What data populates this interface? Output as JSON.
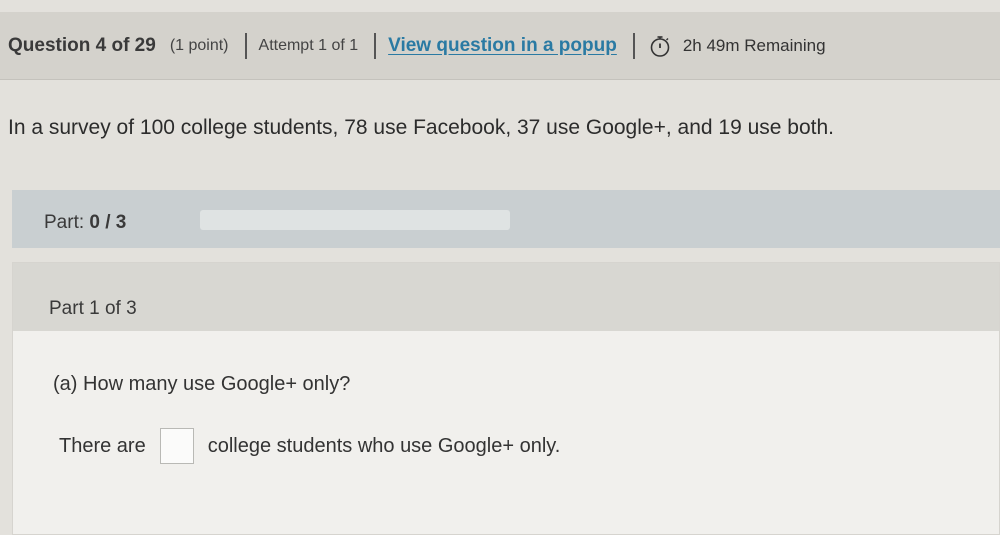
{
  "header": {
    "question_label": "Question 4 of 29",
    "points": "(1 point)",
    "attempt": "Attempt 1 of 1",
    "popup_link": "View question in a popup",
    "time_remaining": "2h 49m Remaining"
  },
  "question": {
    "text": "In a survey of 100 college students, 78 use Facebook, 37 use Google+, and 19 use both."
  },
  "progress": {
    "label": "Part:",
    "completed": "0",
    "total": "3",
    "value": "0 / 3",
    "fraction": 0
  },
  "part1": {
    "title": "Part 1 of 3",
    "prompt": "(a) How many use Google+ only?",
    "answer_before": "There are",
    "answer_after": "college students who use Google+ only.",
    "answer_value": ""
  },
  "colors": {
    "link": "#2a7aa3",
    "progress_fill": "#4a8fb3",
    "part_bar": "#c9cfd1"
  },
  "icons": {
    "timer": "stopwatch-icon"
  }
}
